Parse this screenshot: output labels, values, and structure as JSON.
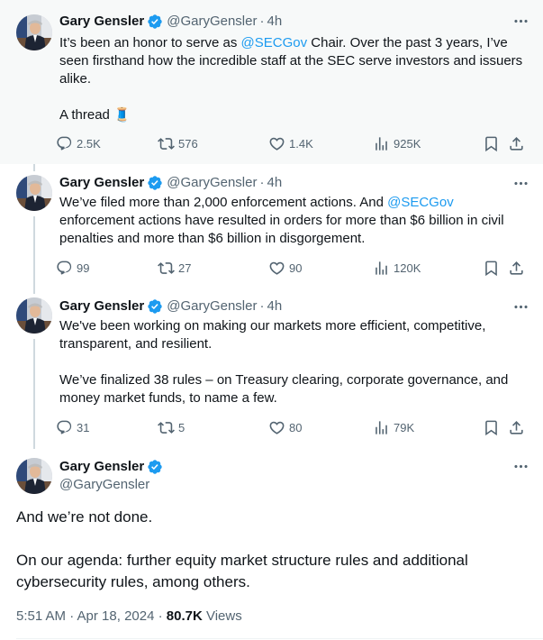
{
  "author": {
    "name": "Gary Gensler",
    "handle": "@GaryGensler",
    "verified_icon": "verified-badge-icon",
    "badge_color": "#1d9bf0"
  },
  "tweets": [
    {
      "time": "4h",
      "text_parts": [
        "It’s been an honor to serve as ",
        "@SECGov",
        " Chair. Over the past 3 years, I’ve seen firsthand how the incredible staff at the SEC serve investors and issuers alike."
      ],
      "text_2": "A thread",
      "emoji": "🧵",
      "stats": {
        "replies": "2.5K",
        "reposts": "576",
        "likes": "1.4K",
        "views": "925K"
      }
    },
    {
      "time": "4h",
      "text_parts": [
        "We’ve filed more than 2,000 enforcement actions. And ",
        "@SECGov",
        " enforcement actions have resulted in orders for more than $6 billion in civil penalties and more than $6 billion in disgorgement."
      ],
      "stats": {
        "replies": "99",
        "reposts": "27",
        "likes": "90",
        "views": "120K"
      }
    },
    {
      "time": "4h",
      "text_1": "We've been working on making our markets more efficient, competitive, transparent, and resilient.",
      "text_2": "We’ve finalized 38 rules – on Treasury clearing, corporate governance, and money market funds, to name a few.",
      "stats": {
        "replies": "31",
        "reposts": "5",
        "likes": "80",
        "views": "79K"
      }
    }
  ],
  "main_tweet": {
    "text_1": "And we’re not done.",
    "text_2": "On our agenda: further equity market structure rules and additional cybersecurity rules, among others.",
    "timestamp": "5:51 AM · Apr 18, 2024",
    "separator": " · ",
    "views_count": "80.7K",
    "views_label": "Views"
  },
  "colors": {
    "accent": "#1d9bf0",
    "secondary_text": "#536471",
    "highlight_bg": "#f7f9f9",
    "thread_line": "#cfd9de"
  }
}
